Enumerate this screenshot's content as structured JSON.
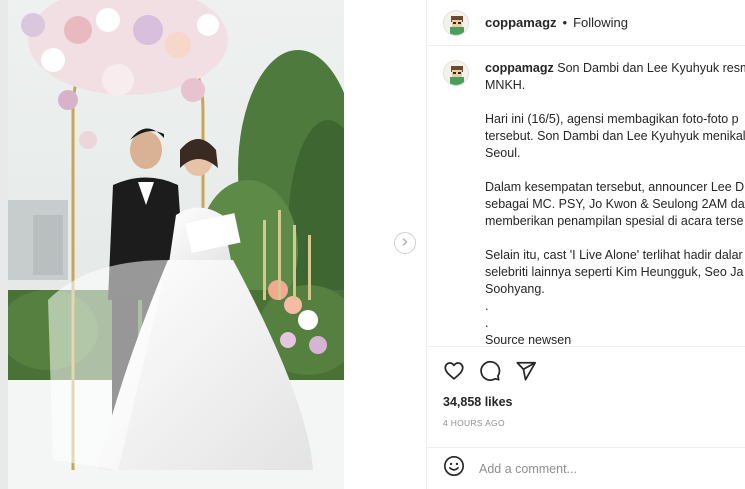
{
  "post": {
    "username": "coppamagz",
    "separator": "•",
    "follow_status": "Following",
    "caption_lines": [
      "Son Dambi dan Lee Kyuhyuk resm",
      "MNKH.",
      "",
      "Hari ini (16/5), agensi membagikan foto-foto p",
      "tersebut. Son Dambi dan Lee Kyuhyuk menikal",
      "Seoul.",
      "",
      "Dalam kesempatan tersebut, announcer Lee D",
      "sebagai MC. PSY, Jo Kwon & Seulong 2AM dat",
      "memberikan penampilan spesial di acara terse",
      "",
      "Selain itu, cast 'I Live Alone' terlihat hadir dalar",
      "selebriti lainnya seperti Kim Heungguk, Seo Ja",
      "Soohyang.",
      ".",
      ".",
      "Source newsen"
    ],
    "likes": "34,858 likes",
    "time": "4 HOURS AGO",
    "comment_placeholder": "Add a comment..."
  },
  "icons": {
    "next": "chevron-right-icon",
    "like": "heart-icon",
    "comment": "comment-icon",
    "share": "paper-plane-icon",
    "emoji": "smiley-icon"
  },
  "colors": {
    "text": "#262626",
    "muted": "#8e8e8e",
    "border": "#efefef"
  }
}
